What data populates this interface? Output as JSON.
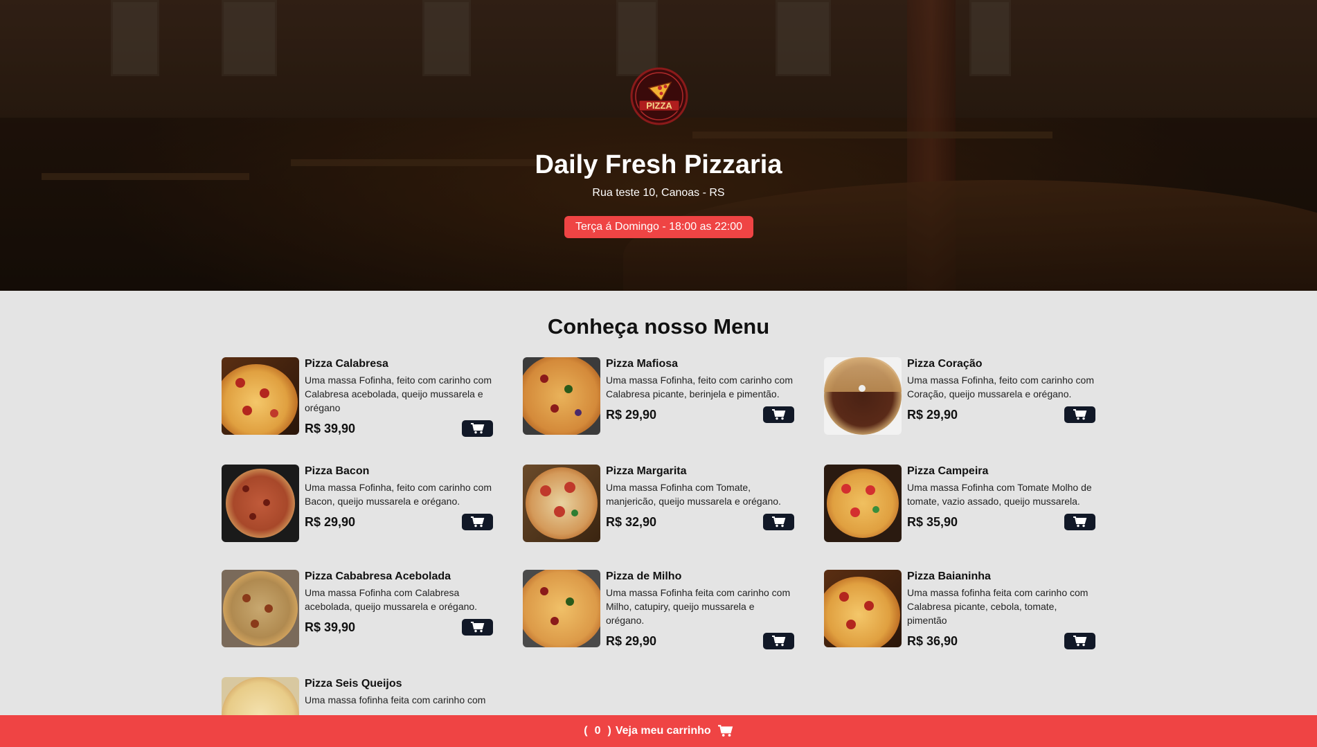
{
  "hero": {
    "title": "Daily Fresh Pizzaria",
    "address": "Rua teste 10, Canoas - RS",
    "hours": "Terça á Domingo - 18:00 as 22:00",
    "logo_text": "PIZZA"
  },
  "menu": {
    "title": "Conheça nosso Menu",
    "items": [
      {
        "name": "Pizza Calabresa",
        "desc": "Uma massa Fofinha, feito com carinho com Calabresa acebolada, queijo mussarela e orégano",
        "price": "R$ 39,90"
      },
      {
        "name": "Pizza Mafiosa",
        "desc": "Uma massa Fofinha, feito com carinho com Calabresa picante, berinjela e pimentão.",
        "price": "R$ 29,90"
      },
      {
        "name": "Pizza Coração",
        "desc": "Uma massa Fofinha, feito com carinho com Coração, queijo mussarela e orégano.",
        "price": "R$ 29,90"
      },
      {
        "name": "Pizza Bacon",
        "desc": "Uma massa Fofinha, feito com carinho com Bacon, queijo mussarela e orégano.",
        "price": "R$ 29,90"
      },
      {
        "name": "Pizza Margarita",
        "desc": "Uma massa Fofinha com Tomate, manjericão, queijo mussarela e orégano.",
        "price": "R$ 32,90"
      },
      {
        "name": "Pizza Campeira",
        "desc": "Uma massa Fofinha com Tomate Molho de tomate, vazio assado, queijo mussarela.",
        "price": "R$ 35,90"
      },
      {
        "name": "Pizza Cababresa Acebolada",
        "desc": "Uma massa Fofinha com Calabresa acebolada, queijo mussarela e orégano.",
        "price": "R$ 39,90"
      },
      {
        "name": "Pizza de Milho",
        "desc": "Uma massa Fofinha feita com carinho com Milho, catupiry, queijo mussarela e orégano.",
        "price": "R$ 29,90"
      },
      {
        "name": "Pizza Baianinha",
        "desc": "Uma massa fofinha feita com carinho com Calabresa picante, cebola, tomate, pimentão",
        "price": "R$ 36,90"
      },
      {
        "name": "Pizza Seis Queijos",
        "desc": "Uma massa fofinha feita com carinho com",
        "price": ""
      }
    ]
  },
  "cart": {
    "open": "(",
    "count": "0",
    "close": ")",
    "label": "Veja meu carrinho"
  },
  "colors": {
    "accent": "#ef4444",
    "button_dark": "#111827",
    "page_bg": "#e4e4e4"
  },
  "icons": {
    "cart": "cart-icon"
  }
}
